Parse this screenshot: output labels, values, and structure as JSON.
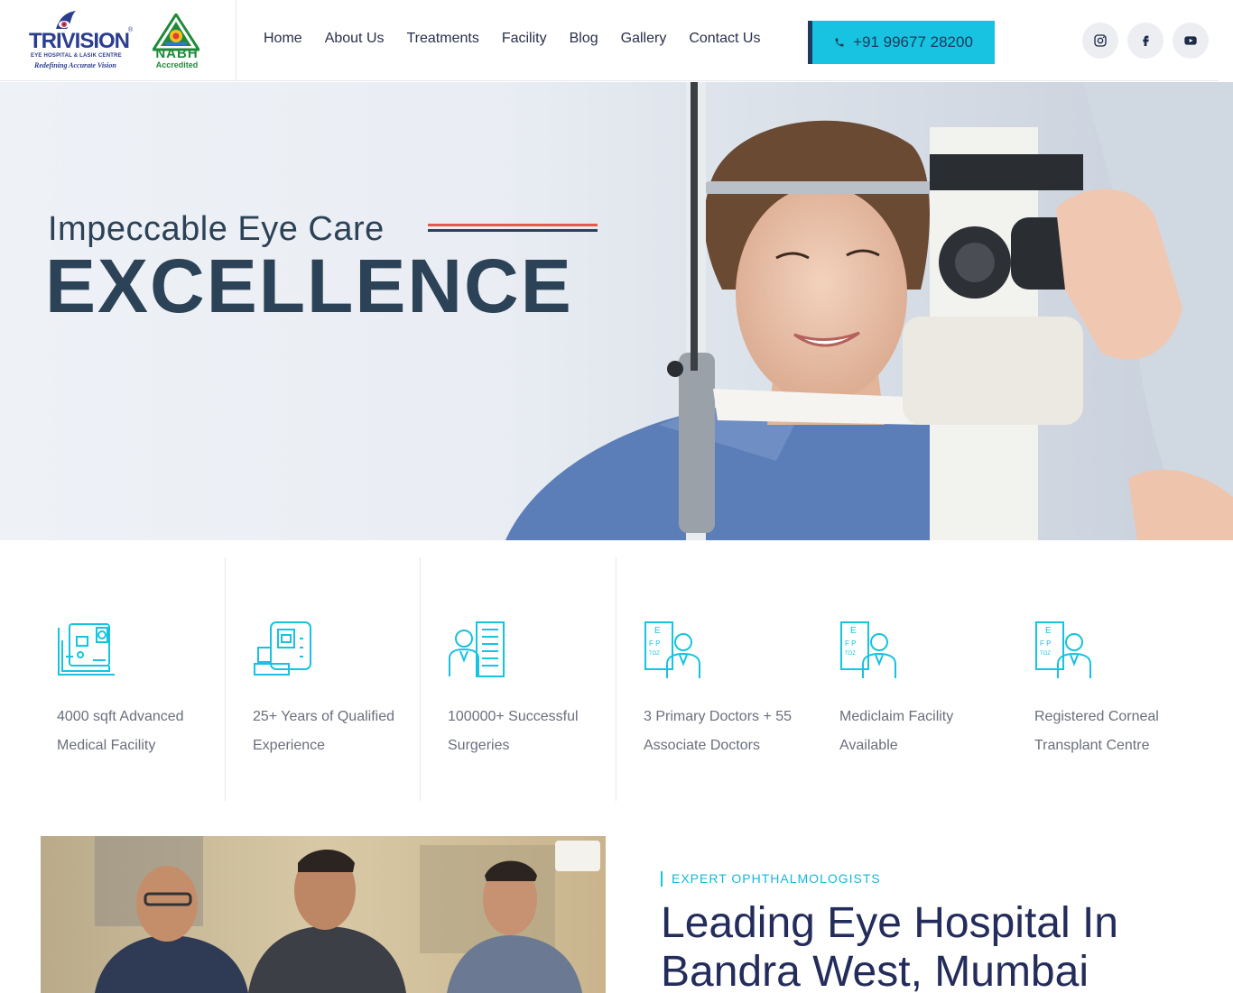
{
  "brand": {
    "name": "TRIVISION",
    "subtitle": "EYE HOSPITAL & LASIK CENTRE",
    "tagline": "Redefining Accurate Vision",
    "accreditation": "NABH",
    "accreditation_sub": "Accredited"
  },
  "nav": {
    "items": [
      "Home",
      "About Us",
      "Treatments",
      "Facility",
      "Blog",
      "Gallery",
      "Contact Us"
    ]
  },
  "header": {
    "phone": "+91 99677 28200",
    "social": [
      "instagram-icon",
      "facebook-icon",
      "youtube-icon"
    ]
  },
  "hero": {
    "title": "Impeccable Eye Care",
    "headline": "EXCELLENCE"
  },
  "features": [
    {
      "icon": "medical-equipment-icon",
      "text": "4000 sqft Advanced Medical Facility"
    },
    {
      "icon": "eye-exam-machine-icon",
      "text": "25+ Years of Qualified Experience"
    },
    {
      "icon": "doctor-chart-icon",
      "text": "100000+ Successful Surgeries"
    },
    {
      "icon": "eye-chart-doctor-icon",
      "text": "3 Primary Doctors + 55 Associate Doctors"
    },
    {
      "icon": "eye-chart-doctor-icon",
      "text": "Mediclaim Facility Available"
    },
    {
      "icon": "eye-chart-doctor-icon",
      "text": "Registered Corneal Transplant Centre"
    }
  ],
  "about": {
    "eyebrow": "EXPERT OPHTHALMOLOGISTS",
    "title": "Leading Eye Hospital In Bandra West, Mumbai"
  },
  "colors": {
    "accent": "#17c3e0",
    "navy": "#1e3a5f",
    "heading": "#2c4257",
    "red_line": "#e8584a"
  }
}
